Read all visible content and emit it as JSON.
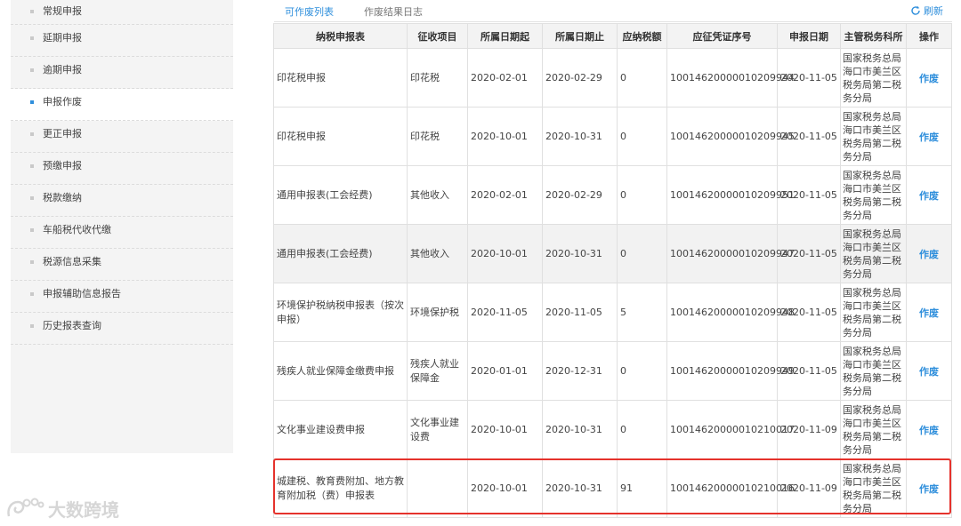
{
  "sidebar": {
    "items": [
      {
        "label": "常规申报",
        "active": false
      },
      {
        "label": "延期申报",
        "active": false
      },
      {
        "label": "逾期申报",
        "active": false
      },
      {
        "label": "申报作废",
        "active": true
      },
      {
        "label": "更正申报",
        "active": false
      },
      {
        "label": "预缴申报",
        "active": false
      },
      {
        "label": "税款缴纳",
        "active": false
      },
      {
        "label": "车船税代收代缴",
        "active": false
      },
      {
        "label": "税源信息采集",
        "active": false
      },
      {
        "label": "申报辅助信息报告",
        "active": false
      },
      {
        "label": "历史报表查询",
        "active": false
      }
    ]
  },
  "tabs": {
    "active": "可作废列表",
    "second": "作废结果日志",
    "refresh": "刷新"
  },
  "table": {
    "headers": [
      "纳税申报表",
      "征收项目",
      "所属日期起",
      "所属日期止",
      "应纳税额",
      "应征凭证序号",
      "申报日期",
      "主管税务科所",
      "操作"
    ],
    "rows": [
      {
        "form": "印花税申报",
        "item": "印花税",
        "start": "2020-02-01",
        "end": "2020-02-29",
        "tax": "0",
        "voucher": "10014620000010209944",
        "date": "2020-11-05",
        "org": "国家税务总局海口市美兰区税务局第二税务分局",
        "op": "作废"
      },
      {
        "form": "印花税申报",
        "item": "印花税",
        "start": "2020-10-01",
        "end": "2020-10-31",
        "tax": "0",
        "voucher": "10014620000010209945",
        "date": "2020-11-05",
        "org": "国家税务总局海口市美兰区税务局第二税务分局",
        "op": "作废"
      },
      {
        "form": "通用申报表(工会经费)",
        "item": "其他收入",
        "start": "2020-02-01",
        "end": "2020-02-29",
        "tax": "0",
        "voucher": "10014620000010209951",
        "date": "2020-11-05",
        "org": "国家税务总局海口市美兰区税务局第二税务分局",
        "op": "作废"
      },
      {
        "form": "通用申报表(工会经费)",
        "item": "其他收入",
        "start": "2020-10-01",
        "end": "2020-10-31",
        "tax": "0",
        "voucher": "10014620000010209947",
        "date": "2020-11-05",
        "org": "国家税务总局海口市美兰区税务局第二税务分局",
        "op": "作废"
      },
      {
        "form": "环境保护税纳税申报表（按次申报）",
        "item": "环境保护税",
        "start": "2020-11-05",
        "end": "2020-11-05",
        "tax": "5",
        "voucher": "10014620000010209948",
        "date": "2020-11-05",
        "org": "国家税务总局海口市美兰区税务局第二税务分局",
        "op": "作废"
      },
      {
        "form": "残疾人就业保障金缴费申报",
        "item": "残疾人就业保障金",
        "start": "2020-01-01",
        "end": "2020-12-31",
        "tax": "0",
        "voucher": "10014620000010209949",
        "date": "2020-11-05",
        "org": "国家税务总局海口市美兰区税务局第二税务分局",
        "op": "作废"
      },
      {
        "form": "文化事业建设费申报",
        "item": "文化事业建设费",
        "start": "2020-10-01",
        "end": "2020-10-31",
        "tax": "0",
        "voucher": "10014620000010210017",
        "date": "2020-11-09",
        "org": "国家税务总局海口市美兰区税务局第二税务分局",
        "op": "作废"
      },
      {
        "form": "城建税、教育费附加、地方教育附加税（费）申报表",
        "item": "",
        "start": "2020-10-01",
        "end": "2020-10-31",
        "tax": "91",
        "voucher": "10014620000010210016",
        "date": "2020-11-09",
        "org": "国家税务总局海口市美兰区税务局第二税务分局",
        "op": "作废"
      }
    ]
  },
  "watermark": "大数跨境",
  "colors": {
    "accent": "#2f8fdc",
    "highlight": "#e5322c"
  }
}
